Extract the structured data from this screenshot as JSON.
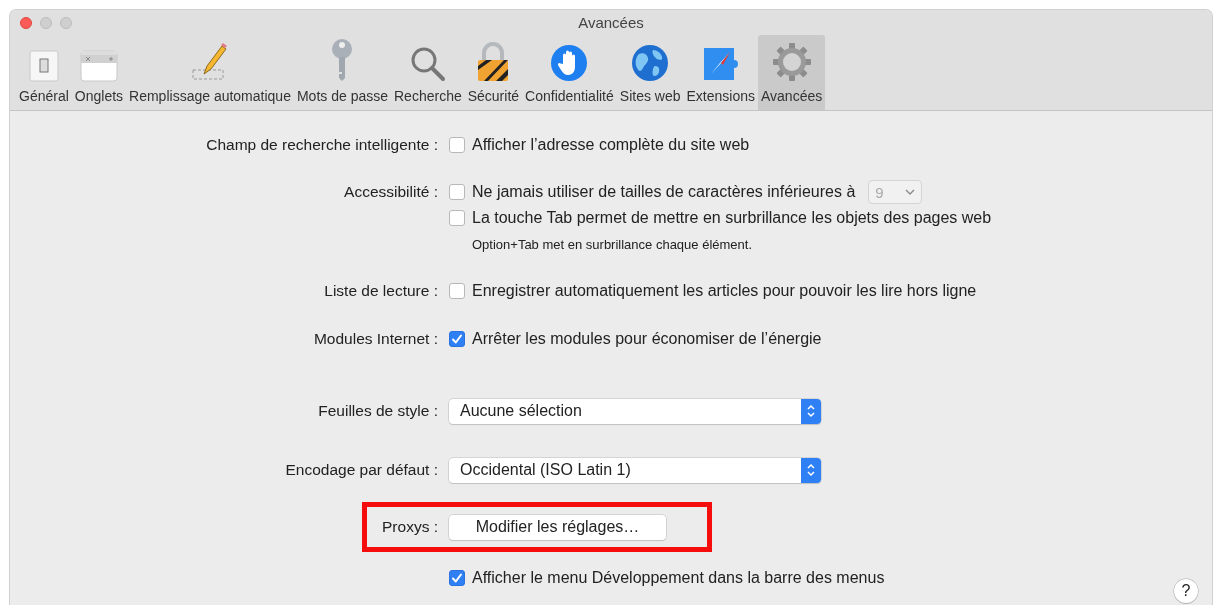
{
  "window": {
    "title": "Avancées"
  },
  "toolbar": [
    {
      "label": "Général",
      "selected": false
    },
    {
      "label": "Onglets",
      "selected": false
    },
    {
      "label": "Remplissage automatique",
      "selected": false
    },
    {
      "label": "Mots de passe",
      "selected": false
    },
    {
      "label": "Recherche",
      "selected": false
    },
    {
      "label": "Sécurité",
      "selected": false
    },
    {
      "label": "Confidentialité",
      "selected": false
    },
    {
      "label": "Sites web",
      "selected": false
    },
    {
      "label": "Extensions",
      "selected": false
    },
    {
      "label": "Avancées",
      "selected": true
    }
  ],
  "sections": [
    {
      "label": "Champ de recherche intelligente :",
      "items": [
        {
          "kind": "checkbox",
          "text": "Afficher l’adresse complète du site web",
          "checked": false
        }
      ]
    },
    {
      "label": "Accessibilité :",
      "items": [
        {
          "kind": "checkbox",
          "text": "Ne jamais utiliser de tailles de caractères inférieures à",
          "checked": false,
          "size": {
            "value": "9",
            "disabled": true
          }
        },
        {
          "kind": "checkbox",
          "text": "La touche Tab permet de mettre en surbrillance les objets des pages web",
          "checked": false
        },
        {
          "kind": "note",
          "text": "Option+Tab met en surbrillance chaque élément."
        }
      ]
    },
    {
      "label": "Liste de lecture :",
      "items": [
        {
          "kind": "checkbox",
          "text": "Enregistrer automatiquement les articles pour pouvoir les lire hors ligne",
          "checked": false
        }
      ]
    },
    {
      "label": "Modules Internet :",
      "items": [
        {
          "kind": "checkbox",
          "text": "Arrêter les modules pour économiser de l’énergie",
          "checked": true
        }
      ]
    },
    {
      "label": "Feuilles de style :",
      "items": [
        {
          "kind": "popup",
          "text": "Aucune sélection"
        }
      ]
    },
    {
      "label": "Encodage par défaut :",
      "items": [
        {
          "kind": "popup",
          "text": "Occidental (ISO Latin 1)"
        }
      ]
    },
    {
      "label": "Proxys :",
      "highlighted": true,
      "items": [
        {
          "kind": "button",
          "text": "Modifier les réglages…"
        }
      ]
    },
    {
      "items": [
        {
          "kind": "checkbox",
          "text": "Afficher le menu Développement dans la barre des menus",
          "checked": true
        }
      ]
    }
  ],
  "help": "?"
}
